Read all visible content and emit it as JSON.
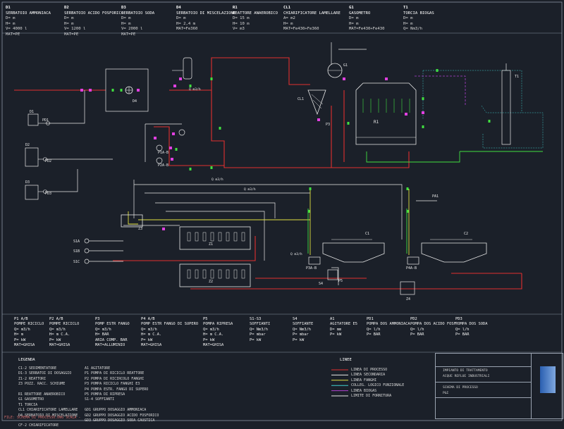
{
  "header_columns": [
    {
      "tag": "D1",
      "title": "SERBATOIO AMMONIACA",
      "lines": [
        "D=  m",
        "H=  m",
        "V= 4000 l",
        "MAT=PE"
      ]
    },
    {
      "tag": "D2",
      "title": "SERBATOIO ACIDO FOSFORICO",
      "lines": [
        "D=  m",
        "H=  m",
        "V= 1200 l",
        "MAT=PE"
      ]
    },
    {
      "tag": "D3",
      "title": "SERBATOIO SODA",
      "lines": [
        "D=  m",
        "H=  m",
        "V= 2000 l",
        "MAT=PE"
      ]
    },
    {
      "tag": "D4",
      "title": "SERBATOIO DI MISCELAZIONE",
      "lines": [
        "D=  m",
        "H= 2,4 m",
        "MAT=Fe360"
      ]
    },
    {
      "tag": "R1",
      "title": "REATTORE ANAEROBICO",
      "lines": [
        "D= 15 m",
        "H= 10 m",
        "V=  m3"
      ]
    },
    {
      "tag": "CL1",
      "title": "CHIARIFICATORE LAMELLARE",
      "lines": [
        "A=  m2",
        "H=  m",
        "MAT=Fe430+Fe360"
      ]
    },
    {
      "tag": "G1",
      "title": "GASOMETRO",
      "lines": [
        "D=  m",
        "H=  m",
        "MAT=Fe430+Fe430"
      ]
    },
    {
      "tag": "T1",
      "title": "TORCIA BIOGAS",
      "lines": [
        "D=  m",
        "H=  m",
        "Q=  Nm3/h"
      ]
    }
  ],
  "bottom_columns": [
    {
      "tag": "P1 A/B",
      "title": "POMPE RICICLO",
      "lines": [
        "Q=  m3/h",
        "H=  m",
        "P=  kW",
        "MAT=GHISA"
      ]
    },
    {
      "tag": "P2 A/B",
      "title": "POMPE RICICLO",
      "lines": [
        "Q=  m3/h",
        "H=  m C.A.",
        "P=  kW",
        "MAT=GHISA"
      ]
    },
    {
      "tag": "P3",
      "title": "POMP ESTR FANGO",
      "lines": [
        "Q=  m3/h",
        "H=  BAR",
        "ARIA COMP.  BAR",
        "MAT=ALLUMINIO"
      ]
    },
    {
      "tag": "P4 A/B",
      "title": "POMP ESTR FANGO DI SUPERO",
      "lines": [
        "Q=  m3/h",
        "H=  m C.A.",
        "P=  kW",
        "MAT=GHISA"
      ]
    },
    {
      "tag": "P5",
      "title": "POMPA RIPRESA",
      "lines": [
        "Q=  m3/h",
        "H=  m C.A.",
        "P=  kW",
        "MAT=GHISA"
      ]
    },
    {
      "tag": "S1-S3",
      "title": "SOFFIANTI",
      "lines": [
        "Q=  Nm3/h",
        "P=  mbar",
        "P=  kW"
      ]
    },
    {
      "tag": "S4",
      "title": "SOFFIANTE",
      "lines": [
        "Q=  Nm3/h",
        "P=  mbar",
        "P=  kW"
      ]
    },
    {
      "tag": "A1",
      "title": "AGITATORE E5",
      "lines": [
        "D=  mm",
        "P=  kW"
      ]
    },
    {
      "tag": "PD1",
      "title": "POMPA DOS AMMONIACA",
      "lines": [
        "Q=  l/h",
        "P=  BAR"
      ]
    },
    {
      "tag": "PD2",
      "title": "POMPA DOS ACIDO FOSF.",
      "lines": [
        "Q=  l/h",
        "P=  BAR"
      ]
    },
    {
      "tag": "PD3",
      "title": "POMPA DOS SODA",
      "lines": [
        "Q=  l/h",
        "P=  BAR"
      ]
    }
  ],
  "legend": {
    "title": "LEGENDA",
    "col1": [
      "C1-2  SEDIMENTATORE",
      "D1-3  SERBATOI DI DOSAGGIO",
      "Z1-2  REATTORI",
      "Z3    POZZ. RACC. SCHIUME",
      "",
      "R1    REATTORE ANAEROBICO",
      "G1    GASOMETRO",
      "T1    TORCIA",
      "CL1   CHIARIFICATORE LAMELLARE",
      "D4    SERBATOIO DI MISCELAZIONE",
      "",
      "CF-2  CHIARIFICATORE"
    ],
    "col2": [
      "A1   AGITATORE",
      "P1   POMPA DI RICICLO REATTORE",
      "P2   POMPA DI RICIRCOLO FANGHI",
      "P3   POMPA RICICLO FANGHI E3",
      "P4   POMPA ESTR. FANGO DI SUPERO",
      "P5   POMPA DI RIPRESA",
      "S1-4 SOFFIANTI",
      "",
      "GD1  GRUPPO DOSAGGIO AMMONIACA",
      "GD2  GRUPPO DOSAGGIO ACIDO FOSFORICO",
      "GD3  GRUPPO DOSAGGIO SODA CAUSTICA"
    ]
  },
  "lines_legend": {
    "title": "LINEE",
    "items": [
      {
        "label": "LINEA DI PROCESSO",
        "color": "#e03030"
      },
      {
        "label": "LINEA SECONDARIA",
        "color": "#e8e8e8"
      },
      {
        "label": "LINEA FANGHI",
        "color": "#e0e040"
      },
      {
        "label": "COLLEG. LOGICO FUNZIONALE",
        "color": "#40d0d0"
      },
      {
        "label": "LINEA BIOGAS",
        "color": "#b040d0"
      },
      {
        "label": "LIMITE DI FORNITURA",
        "color": "#e8e8e8"
      }
    ]
  },
  "title_block": {
    "rows": [
      "IMPIANTO DI TRATTAMENTO",
      "ACQUE REFLUE INDUSTRIALI",
      "SCHEMA DI PROCESSO",
      "P&I"
    ]
  },
  "diagram_labels": {
    "r1": "R1",
    "cl1": "CL1",
    "g1": "G1",
    "t1": "T1",
    "d4": "D4",
    "z1": "Z1",
    "z2": "Z2",
    "z3": "Z3",
    "z4": "Z4",
    "c1": "C1",
    "c2": "C2",
    "p1ab": "P1A-B",
    "p2ab": "P2A-B",
    "p3": "P3",
    "p4": "P4A-B",
    "p5": "P5",
    "p3b": "P3A-B",
    "pd1": "PD1",
    "pd2": "PD2",
    "pd3": "PD3",
    "s1": "S1A",
    "s2": "S1B",
    "s3": "S1C",
    "s4": "S4",
    "d1": "D1",
    "d2": "D2",
    "d3": "D3",
    "flow1": "Q m3/h",
    "flow2": "Q m3/h",
    "flow3": "Q m3/h",
    "flow4": "Q m3/h",
    "pa1": "PA1"
  },
  "footnote": "FILE: SCHEMA_DI_PROCESSO.DWG  SCALA -",
  "colors": {
    "process": "#e03030",
    "secondary": "#e8e8e8",
    "sludge": "#e0e040",
    "logic": "#40d0d0",
    "biogas": "#b040d0",
    "valve": "#e040e0",
    "instrument": "#40e040"
  }
}
